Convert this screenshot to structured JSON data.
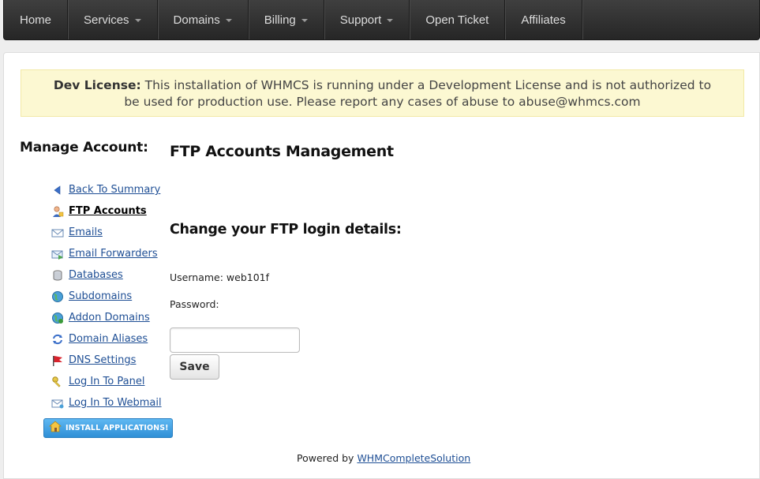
{
  "nav": {
    "items": [
      {
        "label": "Home",
        "has_dropdown": false
      },
      {
        "label": "Services",
        "has_dropdown": true
      },
      {
        "label": "Domains",
        "has_dropdown": true
      },
      {
        "label": "Billing",
        "has_dropdown": true
      },
      {
        "label": "Support",
        "has_dropdown": true
      },
      {
        "label": "Open Ticket",
        "has_dropdown": false
      },
      {
        "label": "Affiliates",
        "has_dropdown": false
      }
    ]
  },
  "license": {
    "label": "Dev License:",
    "text": "This installation of WHMCS is running under a Development License and is not authorized to be used for production use. Please report any cases of abuse to abuse@whmcs.com"
  },
  "sidebar": {
    "title": "Manage Account:",
    "items": [
      {
        "label": "Back To Summary",
        "icon": "back-arrow-icon",
        "active": false
      },
      {
        "label": "FTP Accounts",
        "icon": "ftp-user-icon",
        "active": true
      },
      {
        "label": "Emails",
        "icon": "email-icon",
        "active": false
      },
      {
        "label": "Email Forwarders",
        "icon": "email-forward-icon",
        "active": false
      },
      {
        "label": "Databases",
        "icon": "database-icon",
        "active": false
      },
      {
        "label": "Subdomains",
        "icon": "globe-icon",
        "active": false
      },
      {
        "label": "Addon Domains",
        "icon": "globe-add-icon",
        "active": false
      },
      {
        "label": "Domain Aliases",
        "icon": "refresh-arrows-icon",
        "active": false
      },
      {
        "label": "DNS Settings",
        "icon": "red-flag-icon",
        "active": false
      },
      {
        "label": " Log In To Panel",
        "icon": "key-icon",
        "active": false
      },
      {
        "label": " Log In To Webmail",
        "icon": "webmail-icon",
        "active": false
      }
    ],
    "install_button": "INSTALL APPLICATIONS!"
  },
  "main": {
    "title": "FTP Accounts Management",
    "subtitle": "Change your FTP login details:",
    "username_label": "Username: web101f",
    "password_label": "Password:",
    "password_value": "",
    "save_label": "Save"
  },
  "footer": {
    "prefix": "Powered by ",
    "link": "WHMCompleteSolution"
  },
  "colors": {
    "nav_bg": "#2e2e2e",
    "license_bg": "#fcf8d2",
    "link": "#1f4f95",
    "install_btn": "#3a9be0"
  }
}
